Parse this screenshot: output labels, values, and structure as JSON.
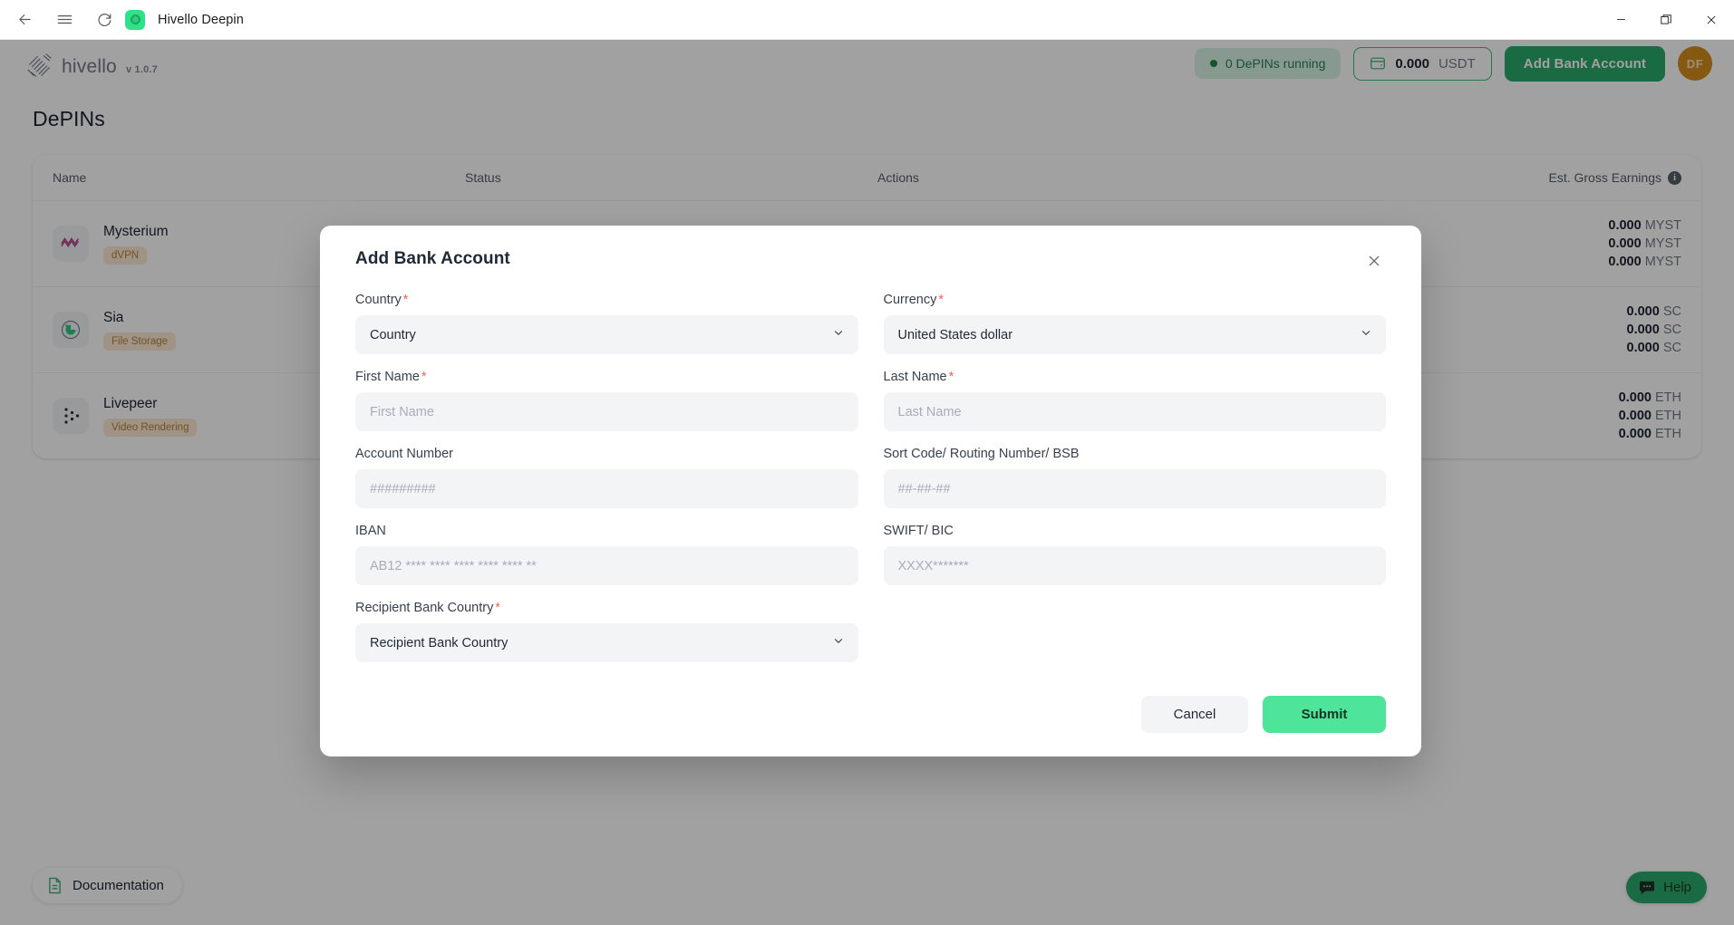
{
  "window": {
    "title": "Hivello Deepin",
    "controls": {
      "minimize": "minimize-icon",
      "maximize": "maximize-icon",
      "close": "close-icon"
    },
    "nav": {
      "back": "back-arrow-icon",
      "menu": "hamburger-menu-icon",
      "reload": "reload-icon"
    }
  },
  "header": {
    "brand_name": "hivello",
    "version": "v 1.0.7",
    "status_pill": "0 DePINs running",
    "wallet_amount": "0.000",
    "wallet_currency": "USDT",
    "add_bank_account_label": "Add Bank Account",
    "avatar_initials": "DF"
  },
  "main": {
    "page_title": "DePINs",
    "columns": [
      "Name",
      "Status",
      "Actions",
      "Est. Gross Earnings"
    ],
    "rows": [
      {
        "name": "Mysterium",
        "tag": "dVPN",
        "earnings": [
          {
            "value": "0.000",
            "unit": "MYST"
          },
          {
            "value": "0.000",
            "unit": "MYST"
          },
          {
            "value": "0.000",
            "unit": "MYST"
          }
        ]
      },
      {
        "name": "Sia",
        "tag": "File Storage",
        "earnings": [
          {
            "value": "0.000",
            "unit": "SC"
          },
          {
            "value": "0.000",
            "unit": "SC"
          },
          {
            "value": "0.000",
            "unit": "SC"
          }
        ]
      },
      {
        "name": "Livepeer",
        "tag": "Video Rendering",
        "earnings": [
          {
            "value": "0.000",
            "unit": "ETH"
          },
          {
            "value": "0.000",
            "unit": "ETH"
          },
          {
            "value": "0.000",
            "unit": "ETH"
          }
        ]
      }
    ]
  },
  "footer": {
    "documentation_label": "Documentation",
    "help_label": "Help"
  },
  "modal": {
    "title": "Add Bank Account",
    "fields": {
      "country": {
        "label": "Country",
        "required": true,
        "value": "Country"
      },
      "currency": {
        "label": "Currency",
        "required": true,
        "value": "United States dollar"
      },
      "first_name": {
        "label": "First Name",
        "required": true,
        "value": "",
        "placeholder": "First Name"
      },
      "last_name": {
        "label": "Last Name",
        "required": true,
        "value": "",
        "placeholder": "Last Name"
      },
      "account_number": {
        "label": "Account Number",
        "required": false,
        "value": "",
        "placeholder": "#########"
      },
      "sort_code": {
        "label": "Sort Code/ Routing Number/ BSB",
        "required": false,
        "value": "",
        "placeholder": "##-##-##"
      },
      "iban": {
        "label": "IBAN",
        "required": false,
        "value": "",
        "placeholder": "AB12 **** **** **** **** **** **"
      },
      "swift": {
        "label": "SWIFT/ BIC",
        "required": false,
        "value": "",
        "placeholder": "XXXX*******"
      },
      "recipient_bank_country": {
        "label": "Recipient Bank Country",
        "required": true,
        "value": "Recipient Bank Country"
      }
    },
    "cancel_label": "Cancel",
    "submit_label": "Submit"
  },
  "colors": {
    "brand_green": "#1fa463",
    "submit_green": "#4ee49a",
    "required_red": "#f4635a",
    "avatar_orange": "#d08710",
    "tag_bg": "#fbe8d0",
    "tag_text": "#b4792e"
  }
}
